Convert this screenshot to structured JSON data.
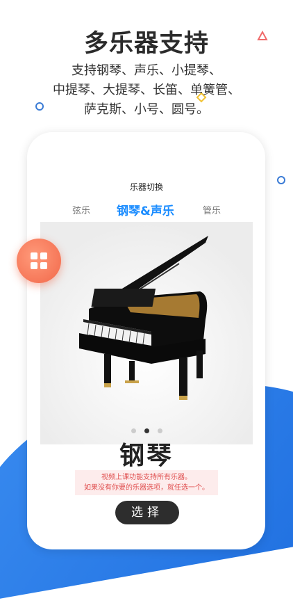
{
  "headline": "多乐器支持",
  "subtitle_lines": [
    "支持钢琴、声乐、小提琴、",
    "中提琴、大提琴、长笛、单簧管、",
    "萨克斯、小号、圆号。"
  ],
  "screen": {
    "title": "乐器切换",
    "tabs": [
      {
        "label": "弦乐",
        "active": false
      },
      {
        "label": "钢琴&声乐",
        "active": true
      },
      {
        "label": "管乐",
        "active": false
      }
    ],
    "carousel": {
      "pages": 3,
      "current": 2
    },
    "instrument_name": "钢琴",
    "notice_lines": [
      "视频上课功能支持所有乐器。",
      "如果没有你要的乐器选项，就任选一个。"
    ],
    "select_label": "选择"
  },
  "icons": {
    "menu": "grid-menu-icon",
    "instrument": "grand-piano-icon"
  },
  "colors": {
    "accent": "#1a8cff",
    "fab": "#f2684a",
    "notice_bg": "#fdecec",
    "notice_text": "#e05050",
    "wave": "#2a7de8"
  }
}
